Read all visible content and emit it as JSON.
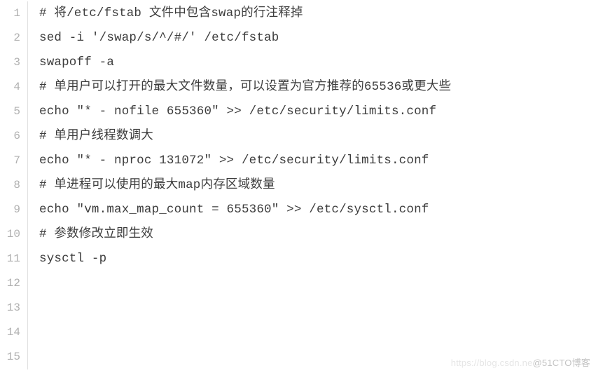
{
  "code": {
    "lines": [
      {
        "num": "1",
        "text": "# 将/etc/fstab 文件中包含swap的行注释掉"
      },
      {
        "num": "2",
        "text": "sed -i '/swap/s/^/#/' /etc/fstab"
      },
      {
        "num": "3",
        "text": "swapoff -a"
      },
      {
        "num": "4",
        "text": ""
      },
      {
        "num": "5",
        "text": "# 单用户可以打开的最大文件数量，可以设置为官方推荐的65536或更大些"
      },
      {
        "num": "6",
        "text": "echo \"* - nofile 655360\" >> /etc/security/limits.conf"
      },
      {
        "num": "7",
        "text": ""
      },
      {
        "num": "8",
        "text": "# 单用户线程数调大"
      },
      {
        "num": "9",
        "text": "echo \"* - nproc 131072\" >> /etc/security/limits.conf"
      },
      {
        "num": "10",
        "text": ""
      },
      {
        "num": "11",
        "text": "# 单进程可以使用的最大map内存区域数量"
      },
      {
        "num": "12",
        "text": "echo \"vm.max_map_count = 655360\" >> /etc/sysctl.conf"
      },
      {
        "num": "13",
        "text": ""
      },
      {
        "num": "14",
        "text": "# 参数修改立即生效"
      },
      {
        "num": "15",
        "text": "sysctl -p"
      }
    ]
  },
  "watermark": {
    "left": "https://blog.csdn.ne",
    "right": "@51CTO博客"
  }
}
